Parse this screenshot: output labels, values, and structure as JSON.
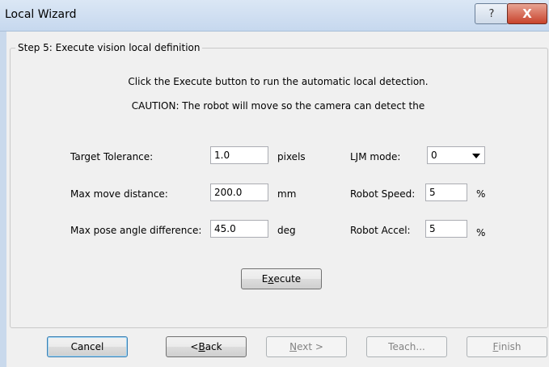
{
  "window": {
    "title": "Local Wizard",
    "help_symbol": "?",
    "close_symbol": "X"
  },
  "step": {
    "title": "Step 5: Execute vision local definition",
    "instruction": "Click the Execute button to run the automatic local detection.",
    "caution": "CAUTION: The robot will move so the camera can detect the"
  },
  "fields": {
    "target_tolerance": {
      "label": "Target Tolerance:",
      "value": "1.0",
      "unit": "pixels"
    },
    "max_move_distance": {
      "label": "Max move distance:",
      "value": "200.0",
      "unit": "mm"
    },
    "max_pose_angle": {
      "label": "Max pose angle difference:",
      "value": "45.0",
      "unit": "deg"
    },
    "ljm_mode": {
      "label": "LJM mode:",
      "value": "0"
    },
    "robot_speed": {
      "label": "Robot Speed:",
      "value": "5",
      "unit": "%"
    },
    "robot_accel": {
      "label": "Robot Accel:",
      "value": "5",
      "unit": "%"
    }
  },
  "buttons": {
    "execute_pre": "E",
    "execute_key": "x",
    "execute_post": "ecute",
    "cancel": "Cancel",
    "back_pre": "< ",
    "back_key": "B",
    "back_post": "ack",
    "next_key": "N",
    "next_post": "ext >",
    "teach": "Teach...",
    "finish_key": "F",
    "finish_post": "inish"
  }
}
